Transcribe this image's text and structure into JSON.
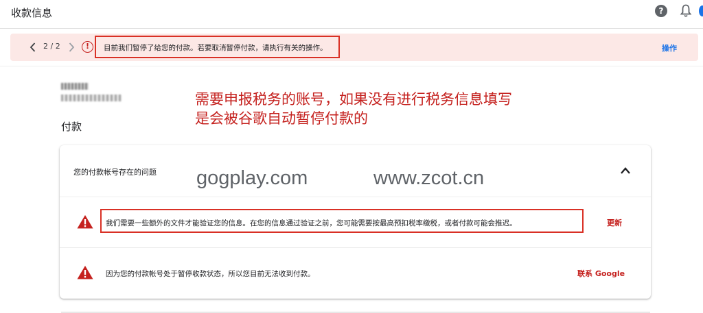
{
  "header": {
    "title": "收款信息",
    "help_icon": "?"
  },
  "alert": {
    "pager": "2 / 2",
    "error_icon": "!",
    "message": "目前我们暂停了给您的付款。若要取消暂停付款，请执行有关的操作。",
    "action": "操作"
  },
  "annotation": {
    "line1": "需要申报税务的账号，如果没有进行税务信息填写",
    "line2": "是会被谷歌自动暂停付款的"
  },
  "section": {
    "title": "付款"
  },
  "issues_card": {
    "header": "您的付款帐号存在的问题",
    "items": [
      {
        "text": "我们需要一些额外的文件才能验证您的信息。在您的信息通过验证之前，您可能需要按最高预扣税率缴税，或者付款可能会推迟。",
        "action": "更新"
      },
      {
        "text": "因为您的付款帐号处于暂停收款状态，所以您目前无法收到付款。",
        "action": "联系 Google"
      }
    ]
  },
  "watermarks": [
    "gogplay.com",
    "www.zcot.cn"
  ],
  "colors": {
    "alert_bg": "#fce8e6",
    "annotation_red": "#c5221f",
    "link_blue": "#1a73e8",
    "warning_red": "#d93025"
  }
}
